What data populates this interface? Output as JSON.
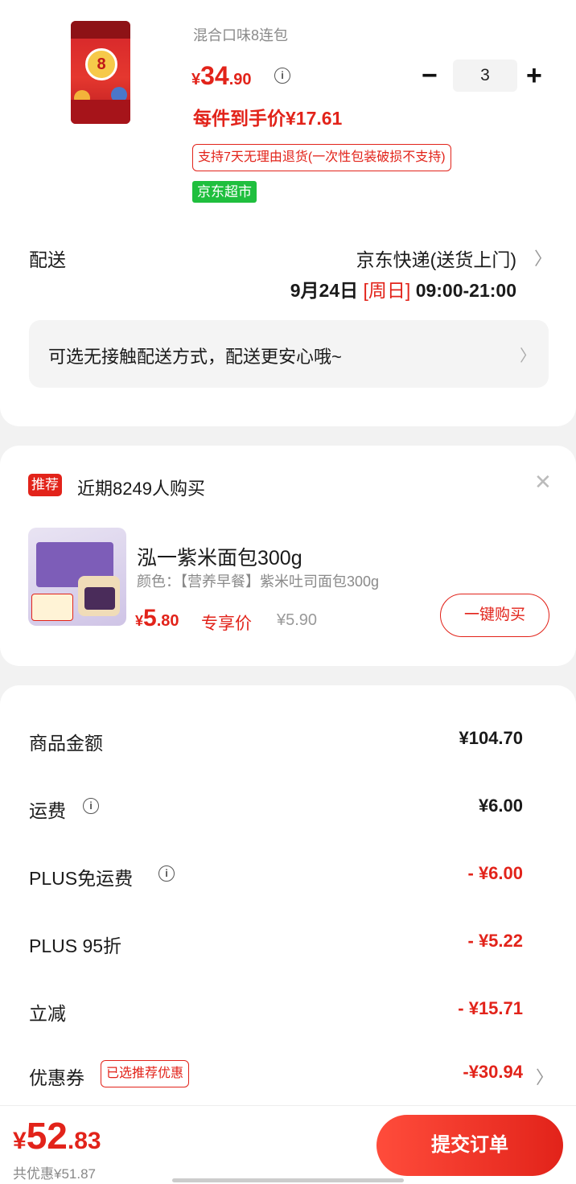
{
  "product": {
    "variant": "混合口味8连包",
    "price_currency": "¥",
    "price_int": "34",
    "price_dec": ".90",
    "quantity": "3",
    "unit_price": "每件到手价¥17.61",
    "return_policy": "支持7天无理由退货(一次性包装破损不支持)",
    "store_tag": "京东超市",
    "image_text": "8"
  },
  "delivery": {
    "label": "配送",
    "method": "京东快递(送货上门)",
    "date": "9月24日",
    "weekday": "[周日]",
    "time": "09:00-21:00",
    "contactless": "可选无接触配送方式，配送更安心哦~"
  },
  "recommend": {
    "tag": "推荐",
    "text": "近期8249人购买",
    "name": "泓一紫米面包300g",
    "spec": "颜色：【营养早餐】紫米吐司面包300g",
    "price_currency": "¥",
    "price_int": "5",
    "price_dec": ".80",
    "exclusive_label": "专享价",
    "original_price": "¥5.90",
    "buy_label": "一键购买"
  },
  "summary": {
    "rows": [
      {
        "label": "商品金额",
        "value": "¥104.70"
      },
      {
        "label": "运费",
        "value": "¥6.00"
      },
      {
        "label": "PLUS免运费",
        "value": "- ¥6.00"
      },
      {
        "label": "PLUS 95折",
        "value": "- ¥5.22"
      },
      {
        "label": "立减",
        "value": "- ¥15.71"
      },
      {
        "label": "优惠券",
        "value": "-¥30.94"
      }
    ],
    "coupon_tag": "已选推荐优惠"
  },
  "footer": {
    "total_currency": "¥",
    "total_int": "52",
    "total_dec": ".83",
    "saved": "共优惠¥51.87",
    "submit_label": "提交订单"
  },
  "colors": {
    "accent": "#e2231a",
    "store_green": "#1fbf3e"
  },
  "icons": [
    "info-icon",
    "minus-icon",
    "plus-icon",
    "chevron-right-icon",
    "close-icon"
  ]
}
